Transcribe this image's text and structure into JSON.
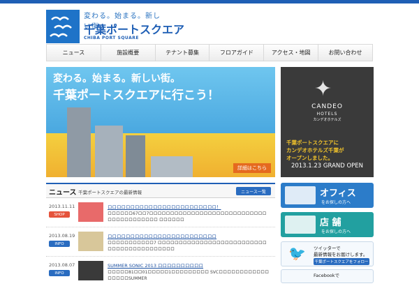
{
  "header": {
    "tagline": "変わる。始まる。新しい街。",
    "name": "千葉ポートスクエア",
    "name_en": "CHIBA PORT SQUARE"
  },
  "nav": [
    "ニュース",
    "施設概要",
    "テナント募集",
    "フロアガイド",
    "アクセス・地図",
    "お問い合わせ"
  ],
  "hero": {
    "line1": "変わる。始まる。新しい街。",
    "line2": "千葉ポートスクエアに行こう！",
    "detail": "詳細はこちら"
  },
  "candeo": {
    "brand": "CANDEO",
    "sub": "HOTELS",
    "kana": "カンデオホテルズ",
    "msg": "千葉ポートスクエアに\nカンデオホテルズ千葉が\nオープンしました。",
    "open": "2013.1.23 GRAND OPEN"
  },
  "news": {
    "title": "ニュース",
    "subtitle": "千葉ポートスクエアの最新情報",
    "list_btn": "ニュース一覧",
    "items": [
      {
        "date": "2013.11.11",
        "badge": "SHOP",
        "badge_color": "#e5533c",
        "title": "ロロロロロロロロロロロロロロロロロロロロロロロロ！",
        "desc": "ロロロロロロ67ロロ7ロロロロロロロロロロロロロロロロロロロロロロロロロロロロロロロロロロロロロロロロ ロロロロロロ",
        "thumb_color": "#e86a6a"
      },
      {
        "date": "2013.08.19",
        "badge": "INFO",
        "badge_color": "#2a6cc0",
        "title": "ロロロロロロロロロロロロロロロロロロロロロロロロ",
        "desc": "ロロロロロロロロロロロ7 ロロロロロロロロロロロロロロロロロロロロロロロロロロロロロロロロロロロロロロロロロロ",
        "thumb_color": "#d8c79a"
      },
      {
        "date": "2013.08.07",
        "badge": "INFO",
        "badge_color": "#2a6cc0",
        "title": "SUMMER SONIC 2013 ロロロロロロロロロロ",
        "desc": "ロロロロロ81ロロ01ロロロロロ1ロロロロロロロロロ SVCロロロロロロロロロロロロロロロロロSUMMER",
        "thumb_color": "#3a3a3a"
      }
    ]
  },
  "side": {
    "office": {
      "big": "オフィス",
      "small": "をお探しの方へ",
      "color": "#2c7cc9"
    },
    "shop": {
      "big": "店 舗",
      "small": "をお探しの方へ",
      "color": "#22a0a0"
    },
    "twitter": {
      "l1": "ツイッターで",
      "l2": "最新情報をお届けします。",
      "btn": "千葉ポートスクエアをフォロー"
    },
    "facebook": {
      "l1": "Facebookで"
    }
  }
}
